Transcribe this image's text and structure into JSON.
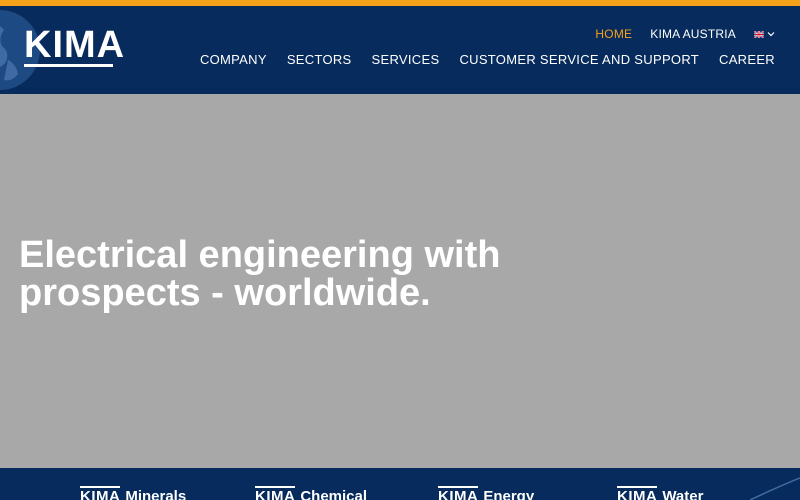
{
  "brand": {
    "logo_text": "KIMA",
    "accent_color": "#f5a11a",
    "header_color": "#062b5c"
  },
  "util_nav": {
    "home": "HOME",
    "austria": "KIMA AUSTRIA",
    "language_icon": "uk-flag-icon"
  },
  "main_nav": {
    "company": "COMPANY",
    "sectors": "SECTORS",
    "services": "SERVICES",
    "support": "CUSTOMER SERVICE AND SUPPORT",
    "career": "CAREER"
  },
  "hero": {
    "title": "Electrical engineering with prospects - worldwide."
  },
  "sectors": [
    {
      "logo": "KIMA",
      "name": "Minerals"
    },
    {
      "logo": "KIMA",
      "name": "Chemical"
    },
    {
      "logo": "KIMA",
      "name": "Energy"
    },
    {
      "logo": "KIMA",
      "name": "Water"
    }
  ]
}
